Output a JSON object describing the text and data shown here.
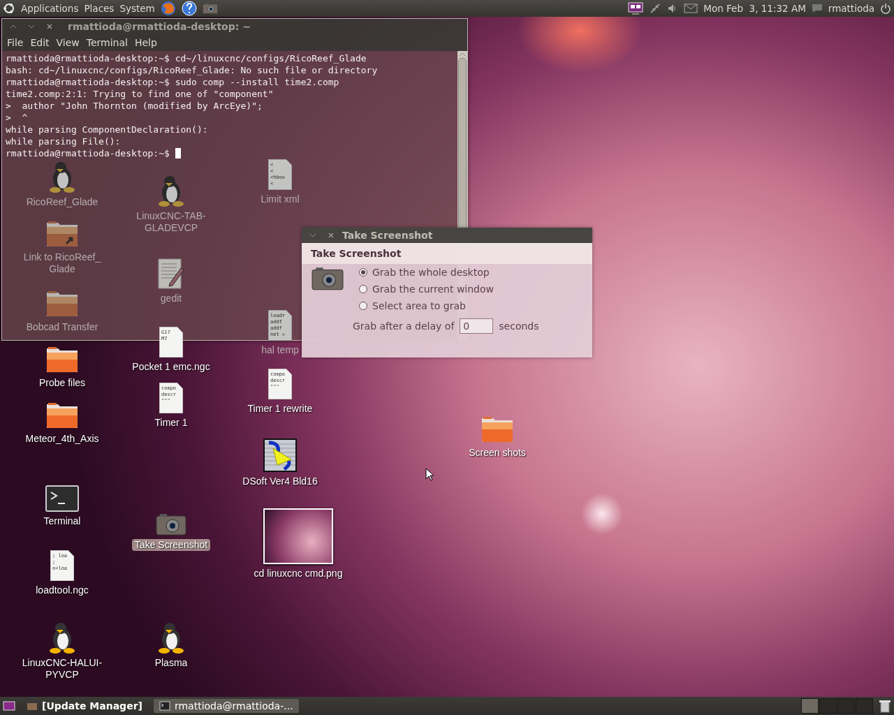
{
  "top_panel": {
    "menus": [
      "Applications",
      "Places",
      "System"
    ],
    "clock": "Mon Feb  3, 11:32 AM",
    "user": "rmattioda"
  },
  "desktop_icons": [
    {
      "kind": "penguin",
      "label": "RicoReef_Glade",
      "selected": false
    },
    {
      "kind": "doc",
      "label": "Limit xml",
      "selected": false,
      "preview_lines": [
        "<",
        "<",
        "<hbox",
        "<"
      ]
    },
    {
      "kind": "penguin",
      "label": "LinuxCNC-TAB-GLADEVCP",
      "selected": false
    },
    {
      "kind": "link-folder",
      "label": "Link to RicoReef_ Glade",
      "selected": false
    },
    {
      "kind": "editor",
      "label": "gedit",
      "selected": false
    },
    {
      "kind": "doc",
      "label": "hal temp",
      "selected": false,
      "preview_lines": [
        "loadr",
        "addf",
        "addf",
        "net ▫"
      ]
    },
    {
      "kind": "folder",
      "label": "Bobcad Transfer",
      "selected": false
    },
    {
      "kind": "doc",
      "label": "Pocket 1 emc.ngc",
      "selected": false,
      "preview_lines": [
        "G17",
        "M7"
      ]
    },
    {
      "kind": "folder",
      "label": "Probe files",
      "selected": false
    },
    {
      "kind": "doc",
      "label": "Timer 1 rewrite",
      "selected": false,
      "preview_lines": [
        "compo",
        "descr",
        "\"\"\""
      ]
    },
    {
      "kind": "doc",
      "label": "Timer 1",
      "selected": false,
      "preview_lines": [
        "compo",
        "descr",
        "\"\"\""
      ]
    },
    {
      "kind": "folder",
      "label": "Meteor_4th_Axis",
      "selected": false
    },
    {
      "kind": "folder",
      "label": "Screen shots",
      "selected": false
    },
    {
      "kind": "app",
      "label": "DSoft Ver4 Bld16",
      "selected": false
    },
    {
      "kind": "terminal",
      "label": "Terminal",
      "selected": false
    },
    {
      "kind": "image",
      "label": "cd linuxcnc cmd.png",
      "selected": false
    },
    {
      "kind": "camera",
      "label": "Take Screenshot",
      "selected": true
    },
    {
      "kind": "doc",
      "label": "loadtool.ngc",
      "selected": false,
      "preview_lines": [
        "; loa",
        ";",
        "o<loa"
      ]
    },
    {
      "kind": "penguin",
      "label": "LinuxCNC-HALUI-PYVCP",
      "selected": false
    },
    {
      "kind": "penguin",
      "label": "Plasma",
      "selected": false
    }
  ],
  "screenshot_dialog": {
    "title": "Take Screenshot",
    "heading": "Take Screenshot",
    "options": [
      {
        "label": "Grab the whole desktop",
        "selected": true
      },
      {
        "label": "Grab the current window",
        "selected": false
      },
      {
        "label": "Select area to grab",
        "selected": false
      }
    ],
    "delay_label": "Grab after a delay of",
    "delay_value": "0",
    "delay_unit": "seconds"
  },
  "terminal": {
    "title": "rmattioda@rmattioda-desktop: ~",
    "menus": [
      "File",
      "Edit",
      "View",
      "Terminal",
      "Help"
    ],
    "lines": [
      "rmattioda@rmattioda-desktop:~$ cd~/linuxcnc/configs/RicoReef_Glade",
      "bash: cd~/linuxcnc/configs/RicoReef_Glade: No such file or directory",
      "rmattioda@rmattioda-desktop:~$ sudo comp --install time2.comp",
      "time2.comp:2:1: Trying to find one of \"component\"",
      ">  author \"John Thornton (modified by ArcEye)\";",
      ">  ^",
      "while parsing ComponentDeclaration():",
      "while parsing File():",
      "rmattioda@rmattioda-desktop:~$ "
    ]
  },
  "taskbar": {
    "tasks": [
      {
        "label": "[Update Manager]",
        "attention": true,
        "selected": false
      },
      {
        "label": "rmattioda@rmattioda-...",
        "attention": false,
        "selected": true
      }
    ],
    "workspaces": [
      {
        "selected": true
      },
      {
        "selected": false
      },
      {
        "selected": false
      },
      {
        "selected": false
      }
    ]
  }
}
